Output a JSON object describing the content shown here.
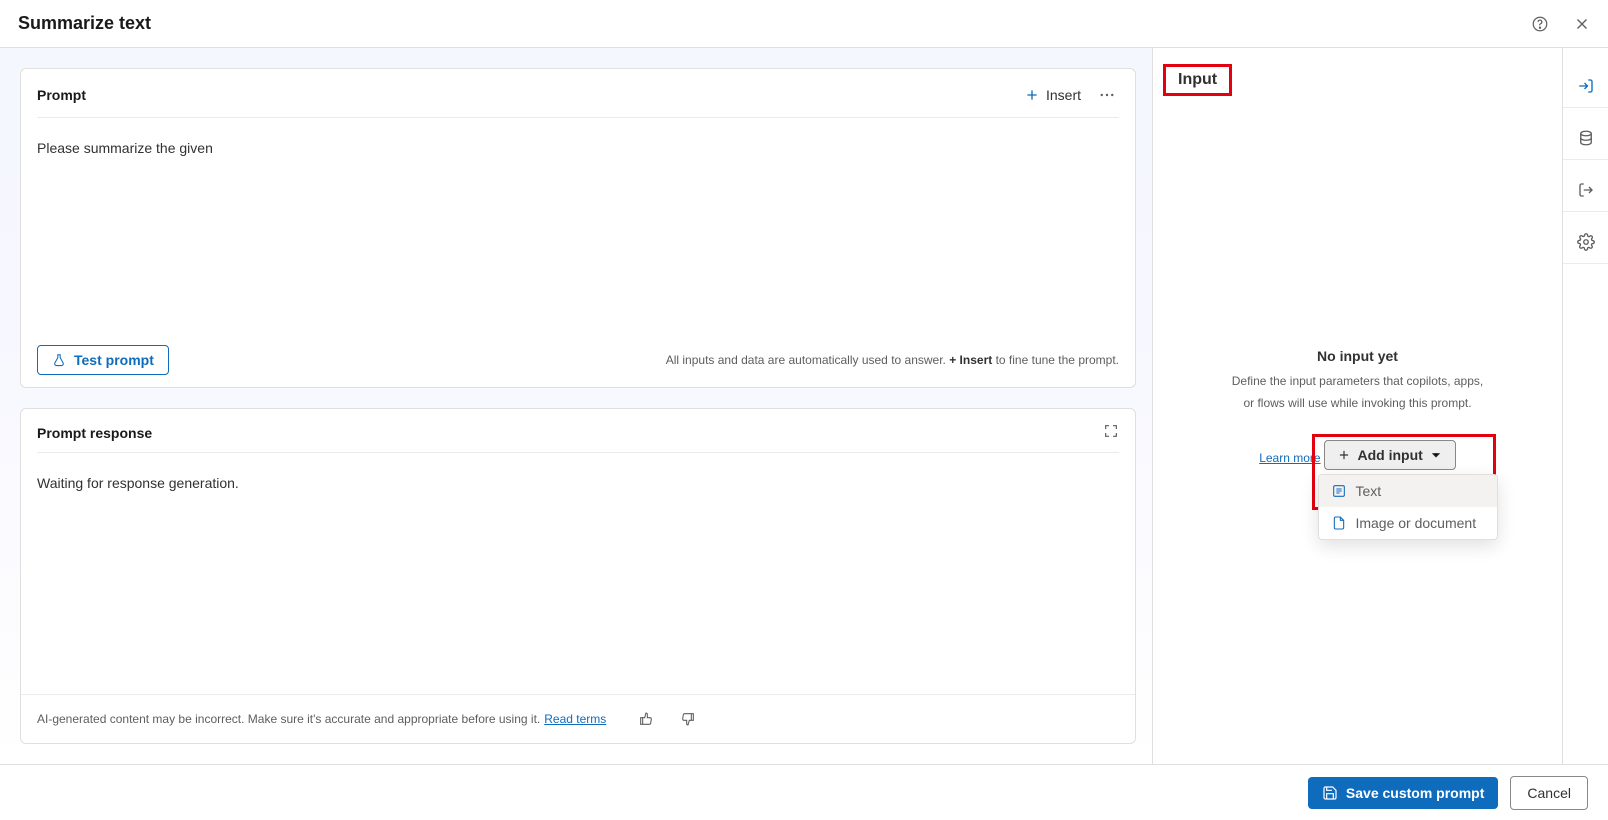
{
  "header": {
    "title": "Summarize text"
  },
  "prompt": {
    "section_title": "Prompt",
    "insert_label": "Insert",
    "content": "Please summarize the given",
    "test_button": "Test prompt",
    "hint_prefix": "All inputs and data are automatically used to answer. ",
    "hint_bold": "+ Insert",
    "hint_suffix": " to fine tune the prompt."
  },
  "response": {
    "section_title": "Prompt response",
    "placeholder": "Waiting for response generation.",
    "disclaimer": "AI-generated content may be incorrect. Make sure it's accurate and appropriate before using it. ",
    "read_terms": "Read terms"
  },
  "right_panel": {
    "tab_label": "Input",
    "empty_title": "No input yet",
    "empty_line1": "Define the input parameters that copilots, apps,",
    "empty_line2": "or flows will use while invoking this prompt.",
    "learn_more": "Learn more",
    "add_input_label": "Add input",
    "menu": {
      "text": "Text",
      "image_or_document": "Image or document"
    }
  },
  "footer": {
    "save": "Save custom prompt",
    "cancel": "Cancel"
  }
}
